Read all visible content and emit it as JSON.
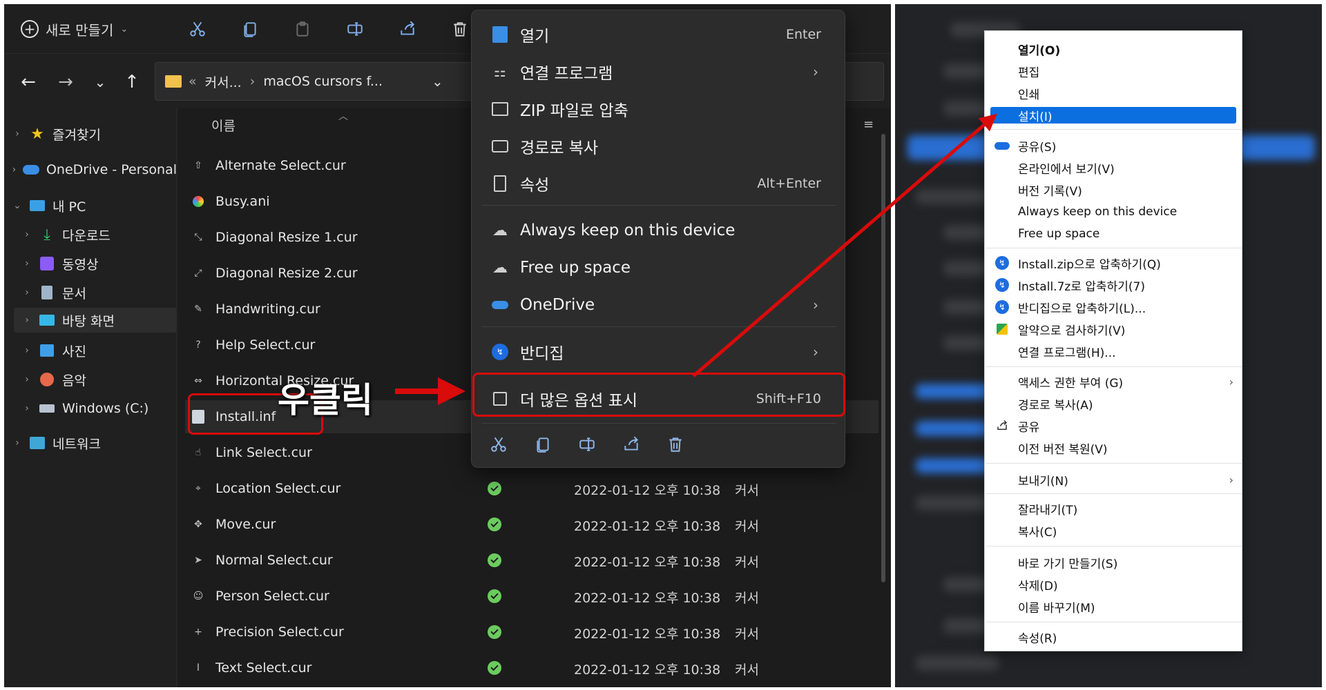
{
  "toolbar": {
    "new_label": "새로 만들기",
    "icons": [
      "cut-icon",
      "copy-icon",
      "paste-icon",
      "rename-icon",
      "share-icon",
      "delete-icon"
    ]
  },
  "address": {
    "segment1": "커서...",
    "segment2": "macOS cursors f..."
  },
  "sidebar": {
    "items": [
      {
        "label": "즐겨찾기",
        "icon": "star-icon"
      },
      {
        "label": "OneDrive - Personal",
        "icon": "cloud-icon"
      },
      {
        "label": "내 PC",
        "icon": "pc-icon"
      },
      {
        "label": "다운로드",
        "icon": "download-icon"
      },
      {
        "label": "동영상",
        "icon": "video-icon"
      },
      {
        "label": "문서",
        "icon": "document-icon"
      },
      {
        "label": "바탕 화면",
        "icon": "desktop-icon"
      },
      {
        "label": "사진",
        "icon": "picture-icon"
      },
      {
        "label": "음악",
        "icon": "music-icon"
      },
      {
        "label": "Windows (C:)",
        "icon": "drive-icon"
      },
      {
        "label": "네트워크",
        "icon": "network-icon"
      }
    ]
  },
  "filelist": {
    "column_name": "이름",
    "files": [
      {
        "name": "Alternate Select.cur"
      },
      {
        "name": "Busy.ani"
      },
      {
        "name": "Diagonal Resize 1.cur"
      },
      {
        "name": "Diagonal Resize 2.cur"
      },
      {
        "name": "Handwriting.cur"
      },
      {
        "name": "Help Select.cur"
      },
      {
        "name": "Horizontal Resize.cur"
      },
      {
        "name": "Install.inf"
      },
      {
        "name": "Link Select.cur"
      },
      {
        "name": "Location Select.cur",
        "date": "2022-01-12 오후 10:38",
        "type": "커서"
      },
      {
        "name": "Move.cur",
        "date": "2022-01-12 오후 10:38",
        "type": "커서"
      },
      {
        "name": "Normal Select.cur",
        "date": "2022-01-12 오후 10:38",
        "type": "커서"
      },
      {
        "name": "Person Select.cur",
        "date": "2022-01-12 오후 10:38",
        "type": "커서"
      },
      {
        "name": "Precision Select.cur",
        "date": "2022-01-12 오후 10:38",
        "type": "커서"
      },
      {
        "name": "Text Select.cur",
        "date": "2022-01-12 오후 10:38",
        "type": "커서"
      }
    ]
  },
  "context_menu": {
    "items": [
      {
        "label": "열기",
        "shortcut": "Enter"
      },
      {
        "label": "연결 프로그램",
        "arrow": "›"
      },
      {
        "label": "ZIP 파일로 압축"
      },
      {
        "label": "경로로 복사"
      },
      {
        "label": "속성",
        "shortcut": "Alt+Enter"
      },
      {
        "label": "Always keep on this device"
      },
      {
        "label": "Free up space"
      },
      {
        "label": "OneDrive",
        "arrow": "›"
      },
      {
        "label": "반디집",
        "arrow": "›"
      },
      {
        "label": "더 많은 옵션 표시",
        "shortcut": "Shift+F10"
      }
    ]
  },
  "annotation": {
    "right_click": "우클릭"
  },
  "classic_menu": {
    "items": [
      {
        "label": "열기(O)",
        "bold": true
      },
      {
        "label": "편집"
      },
      {
        "label": "인쇄"
      },
      {
        "label": "설치(I)",
        "selected": true
      },
      {
        "label": "공유(S)",
        "icon": "onedrive-icon"
      },
      {
        "label": "온라인에서 보기(V)"
      },
      {
        "label": "버전 기록(V)"
      },
      {
        "label": "Always keep on this device"
      },
      {
        "label": "Free up space"
      },
      {
        "label": "Install.zip으로 압축하기(Q)",
        "icon": "bandizip-icon"
      },
      {
        "label": "Install.7z로 압축하기(7)",
        "icon": "bandizip-icon"
      },
      {
        "label": "반디집으로 압축하기(L)...",
        "icon": "bandizip-icon"
      },
      {
        "label": "알약으로 검사하기(V)",
        "icon": "alyac-icon"
      },
      {
        "label": "연결 프로그램(H)..."
      },
      {
        "label": "액세스 권한 부여 (G)",
        "arrow": "›"
      },
      {
        "label": "경로로 복사(A)"
      },
      {
        "label": "공유",
        "icon": "share-icon"
      },
      {
        "label": "이전 버전 복원(V)"
      },
      {
        "label": "보내기(N)",
        "arrow": "›"
      },
      {
        "label": "잘라내기(T)"
      },
      {
        "label": "복사(C)"
      },
      {
        "label": "바로 가기 만들기(S)"
      },
      {
        "label": "삭제(D)"
      },
      {
        "label": "이름 바꾸기(M)"
      },
      {
        "label": "속성(R)"
      }
    ]
  },
  "colors": {
    "accent": "#0b6fe0",
    "annotation_red": "#d90b0b",
    "sync_ok": "#6ccb5f"
  }
}
